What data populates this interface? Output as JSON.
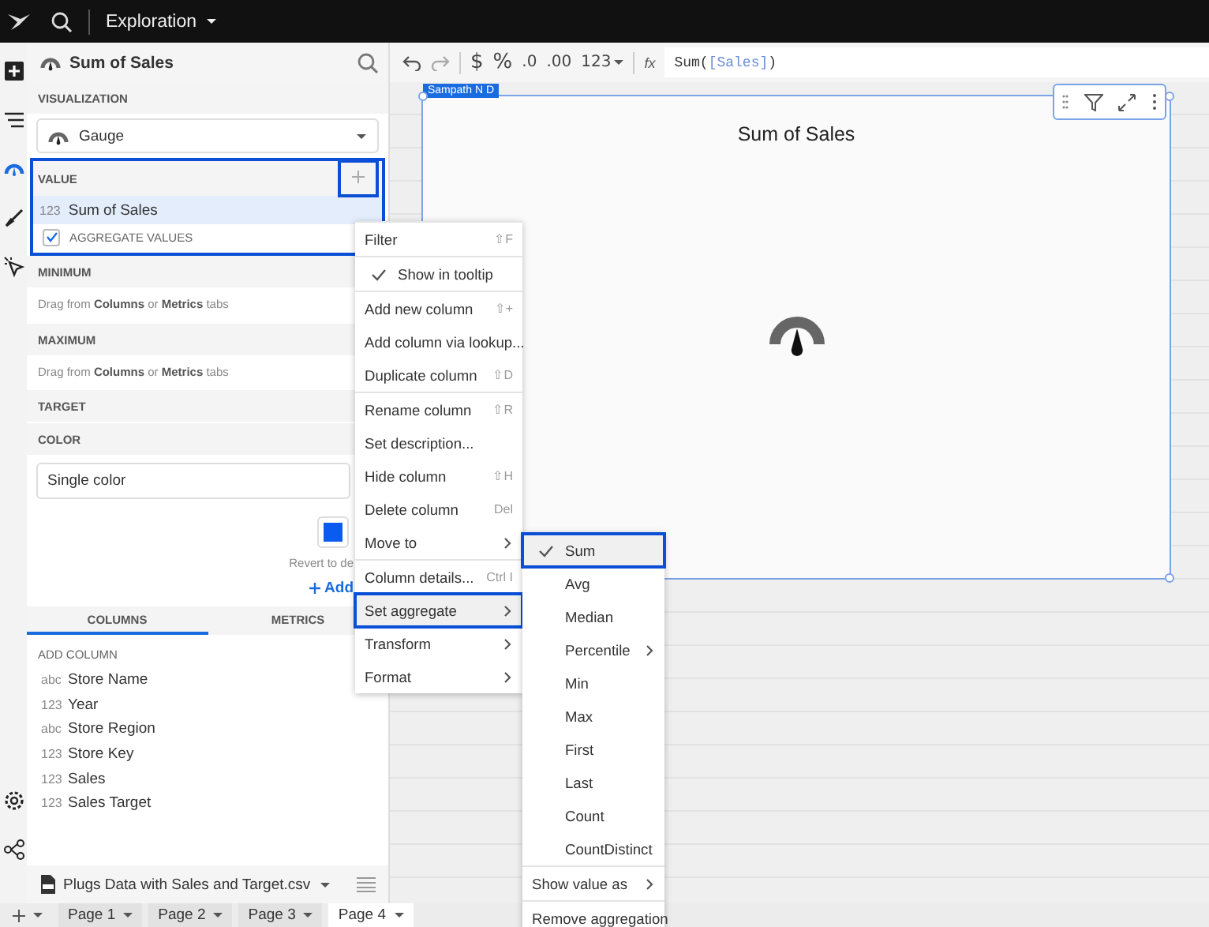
{
  "top_bar": {
    "title": "Exploration"
  },
  "rail": [
    {
      "kind": "add",
      "selected": false
    },
    {
      "kind": "outline",
      "selected": false
    },
    {
      "kind": "gauge",
      "selected": true
    },
    {
      "kind": "brush",
      "selected": false
    },
    {
      "kind": "pointer",
      "selected": false
    },
    {
      "kind": "gear",
      "selected": false
    },
    {
      "kind": "nodes",
      "selected": false
    }
  ],
  "panel": {
    "title": "Sum of Sales",
    "visualization": {
      "label": "VISUALIZATION",
      "value": "Gauge"
    },
    "value": {
      "label": "VALUE",
      "highlighted": true,
      "add_highlighted": true,
      "field": {
        "type": "123",
        "name": "Sum of Sales"
      },
      "aggregate": {
        "label": "AGGREGATE VALUES",
        "checked": true
      }
    },
    "minimum": {
      "label": "MINIMUM",
      "hint": "Drag from **Columns** or **Metrics** tabs"
    },
    "maximum": {
      "label": "MAXIMUM",
      "hint": "Drag from **Columns** or **Metrics** tabs"
    },
    "target": {
      "label": "TARGET"
    },
    "color": {
      "label": "COLOR",
      "value": "Single color",
      "revert": "Revert to de",
      "add": "Add"
    },
    "tabs": [
      {
        "label": "COLUMNS",
        "selected": true
      },
      {
        "label": "METRICS",
        "selected": false
      }
    ],
    "add_column": "ADD COLUMN",
    "columns": [
      {
        "type": "abc",
        "name": "Store Name"
      },
      {
        "type": "123",
        "name": "Year"
      },
      {
        "type": "abc",
        "name": "Store Region"
      },
      {
        "type": "123",
        "name": "Store Key"
      },
      {
        "type": "123",
        "name": "Sales"
      },
      {
        "type": "123",
        "name": "Sales Target"
      }
    ],
    "source": "Plugs Data with Sales and Target.csv"
  },
  "toolbar": {
    "formats": [
      "$",
      "%",
      ".0",
      ".00",
      "123"
    ],
    "fx": "fx",
    "formula": [
      {
        "kind": "func",
        "text": "Sum("
      },
      {
        "kind": "ref",
        "text": "[Sales]"
      },
      {
        "kind": "func",
        "text": ")"
      }
    ]
  },
  "chart": {
    "owner": "Sampath N D",
    "title": "Sum of Sales"
  },
  "context_menu": {
    "groups": [
      [
        {
          "kind": "action",
          "label": "Filter",
          "shortcut": "⇧F",
          "checked": false,
          "highlighted": false
        }
      ],
      [
        {
          "kind": "check",
          "label": "Show in tooltip",
          "checked": true,
          "highlighted": false
        }
      ],
      [
        {
          "kind": "action",
          "label": "Add new column",
          "shortcut": "⇧+",
          "checked": false,
          "highlighted": false
        },
        {
          "kind": "action",
          "label": "Add column via lookup...",
          "checked": false,
          "highlighted": false
        },
        {
          "kind": "action",
          "label": "Duplicate column",
          "shortcut": "⇧D",
          "checked": false,
          "highlighted": false
        }
      ],
      [
        {
          "kind": "action",
          "label": "Rename column",
          "shortcut": "⇧R",
          "checked": false,
          "highlighted": false
        },
        {
          "kind": "action",
          "label": "Set description...",
          "checked": false,
          "highlighted": false
        },
        {
          "kind": "action",
          "label": "Hide column",
          "shortcut": "⇧H",
          "checked": false,
          "highlighted": false
        },
        {
          "kind": "action",
          "label": "Delete column",
          "shortcut": "Del",
          "checked": false,
          "highlighted": false
        },
        {
          "kind": "action",
          "label": "Move to",
          "submenu": true,
          "checked": false,
          "highlighted": false
        }
      ],
      [
        {
          "kind": "action",
          "label": "Column details...",
          "shortcut": "Ctrl I",
          "checked": false,
          "highlighted": false
        },
        {
          "kind": "action",
          "label": "Set aggregate",
          "submenu": true,
          "checked": false,
          "highlighted": true
        },
        {
          "kind": "action",
          "label": "Transform",
          "submenu": true,
          "checked": false,
          "highlighted": false
        },
        {
          "kind": "action",
          "label": "Format",
          "submenu": true,
          "checked": false,
          "highlighted": false
        }
      ]
    ]
  },
  "aggregate_menu": {
    "groups": [
      [
        {
          "kind": "check",
          "label": "Sum",
          "checked": true,
          "highlighted": true
        },
        {
          "kind": "check",
          "label": "Avg",
          "checked": false,
          "highlighted": false
        },
        {
          "kind": "check",
          "label": "Median",
          "checked": false,
          "highlighted": false
        },
        {
          "kind": "check",
          "label": "Percentile",
          "checked": false,
          "submenu": true,
          "highlighted": false
        },
        {
          "kind": "check",
          "label": "Min",
          "checked": false,
          "highlighted": false
        },
        {
          "kind": "check",
          "label": "Max",
          "checked": false,
          "highlighted": false
        },
        {
          "kind": "check",
          "label": "First",
          "checked": false,
          "highlighted": false
        },
        {
          "kind": "check",
          "label": "Last",
          "checked": false,
          "highlighted": false
        },
        {
          "kind": "check",
          "label": "Count",
          "checked": false,
          "highlighted": false
        },
        {
          "kind": "check",
          "label": "CountDistinct",
          "checked": false,
          "highlighted": false
        }
      ],
      [
        {
          "kind": "action",
          "label": "Show value as",
          "submenu": true,
          "checked": false,
          "highlighted": false
        }
      ],
      [
        {
          "kind": "action",
          "label": "Remove aggregation",
          "checked": false,
          "highlighted": false
        }
      ]
    ]
  },
  "pages": [
    {
      "label": "Page 1",
      "selected": false
    },
    {
      "label": "Page 2",
      "selected": false
    },
    {
      "label": "Page 3",
      "selected": false
    },
    {
      "label": "Page 4",
      "selected": true
    }
  ]
}
